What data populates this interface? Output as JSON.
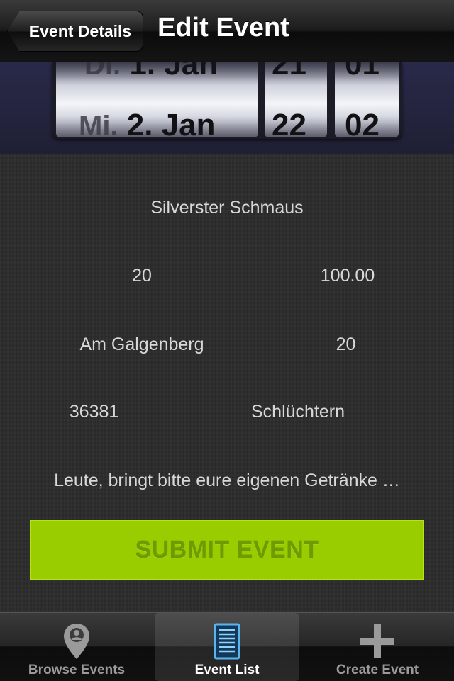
{
  "nav": {
    "back_label": "Event Details",
    "title": "Edit Event"
  },
  "picker": {
    "day_prev": "Di.",
    "date_prev": "1. Jan",
    "day_sel": "Mi.",
    "date_sel": "2. Jan",
    "hour_prev": "21",
    "hour_sel": "22",
    "min_prev": "01",
    "min_sel": "02"
  },
  "form": {
    "name": "Silverster Schmaus",
    "capacity": "20",
    "price": "100.00",
    "street": "Am Galgenberg",
    "house_number": "20",
    "zip": "36381",
    "city": "Schlüchtern",
    "description": "Leute, bringt bitte eure eigenen Getränke …",
    "submit_label": "SUBMIT EVENT"
  },
  "tabs": [
    {
      "label": "Browse Events",
      "icon": "location-pin-icon",
      "active": false
    },
    {
      "label": "Event List",
      "icon": "list-document-icon",
      "active": true
    },
    {
      "label": "Create Event",
      "icon": "plus-icon",
      "active": false
    }
  ],
  "colors": {
    "accent_green": "#9acd00",
    "tab_active_icon": "#5ab4f0"
  }
}
